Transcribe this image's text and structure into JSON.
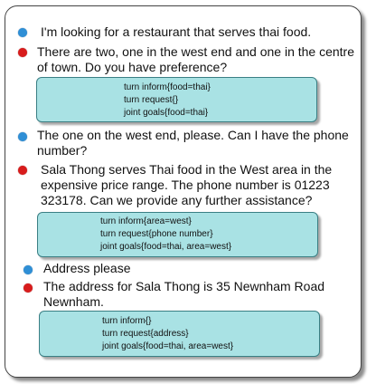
{
  "colors": {
    "user_dot": "#2f8fd6",
    "system_dot": "#d81c1c",
    "state_box": "#a9e2e4",
    "state_border": "#3a7f84"
  },
  "dialogue": [
    {
      "speaker": "user",
      "lines": [
        "I'm looking for a restaurant that serves thai food."
      ]
    },
    {
      "speaker": "system",
      "lines": [
        "There are two, one in the west end and one in the centre",
        "of town. Do you have preference?"
      ]
    },
    {
      "type": "state",
      "inform": "turn inform{food=thai}",
      "request": "turn request{}",
      "joint": "joint goals{food=thai}"
    },
    {
      "speaker": "user",
      "lines": [
        "The one on the west end, please. Can I have the phone",
        "number?"
      ]
    },
    {
      "speaker": "system",
      "lines": [
        "Sala Thong serves Thai food in the West area in the",
        "expensive price range. The phone number is 01223",
        "323178. Can we provide any further assistance?"
      ]
    },
    {
      "type": "state",
      "inform": "turn inform{area=west}",
      "request": "turn request{phone number}",
      "joint": "joint goals{food=thai, area=west}"
    },
    {
      "speaker": "user",
      "lines": [
        "Address please"
      ]
    },
    {
      "speaker": "system",
      "lines": [
        "The address for Sala Thong is 35 Newnham Road",
        "Newnham."
      ]
    },
    {
      "type": "state",
      "inform": "turn inform{}",
      "request": "turn request{address}",
      "joint": "joint goals{food=thai, area=west}"
    }
  ]
}
